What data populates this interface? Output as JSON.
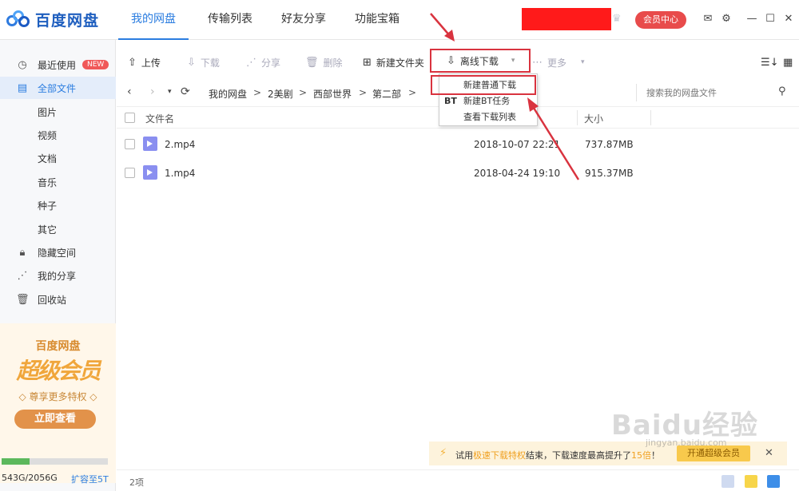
{
  "app": {
    "logo_text": "百度网盘"
  },
  "nav": {
    "tabs": [
      "我的网盘",
      "传输列表",
      "好友分享",
      "功能宝箱"
    ],
    "active": 0
  },
  "header": {
    "vip_label": "会员中心",
    "icons": [
      "crown-icon",
      "mail-icon",
      "settings-icon",
      "minimize-icon",
      "maximize-icon",
      "close-icon"
    ]
  },
  "sidebar": {
    "recent": {
      "label": "最近使用",
      "badge": "NEW"
    },
    "all_files": "全部文件",
    "categories": [
      "图片",
      "视频",
      "文档",
      "音乐",
      "种子",
      "其它"
    ],
    "hidden_space": "隐藏空间",
    "my_share": "我的分享",
    "recycle": "回收站"
  },
  "promo": {
    "brand": "百度网盘",
    "title": "超级会员",
    "tagline": "◇ 尊享更多特权 ◇",
    "button": "立即查看"
  },
  "quota": {
    "text": "543G/2056G",
    "expand": "扩容至5T",
    "used_fraction": 0.264
  },
  "toolbar": {
    "upload": "上传",
    "download": "下载",
    "share": "分享",
    "delete": "删除",
    "new_folder": "新建文件夹",
    "offline_download": "离线下载",
    "more": "更多"
  },
  "breadcrumb": [
    "我的网盘",
    "2美剧",
    "西部世界",
    "第二部"
  ],
  "search": {
    "placeholder": "搜索我的网盘文件"
  },
  "table": {
    "headers": {
      "name": "文件名",
      "size": "大小"
    },
    "rows": [
      {
        "name": "2.mp4",
        "date": "2018-10-07 22:21",
        "size": "737.87MB"
      },
      {
        "name": "1.mp4",
        "date": "2018-04-24 19:10",
        "size": "915.37MB"
      }
    ]
  },
  "dropdown": {
    "items": [
      "新建普通下载",
      "新建BT任务",
      "查看下载列表"
    ],
    "bt_prefix": "BT"
  },
  "notify": {
    "prefix": "试用",
    "highlight1": "极速下载特权",
    "middle": "结束，下载速度最高提升了",
    "highlight2": "15倍",
    "suffix": "！",
    "button": "开通超级会员"
  },
  "status": {
    "count": "2项"
  },
  "watermark": {
    "main": "Baidu经验",
    "sub": "jingyan.baidu.com"
  },
  "colors": {
    "accent": "#2b7de0",
    "annotation": "#d9333f",
    "vip": "#e84b4b"
  }
}
